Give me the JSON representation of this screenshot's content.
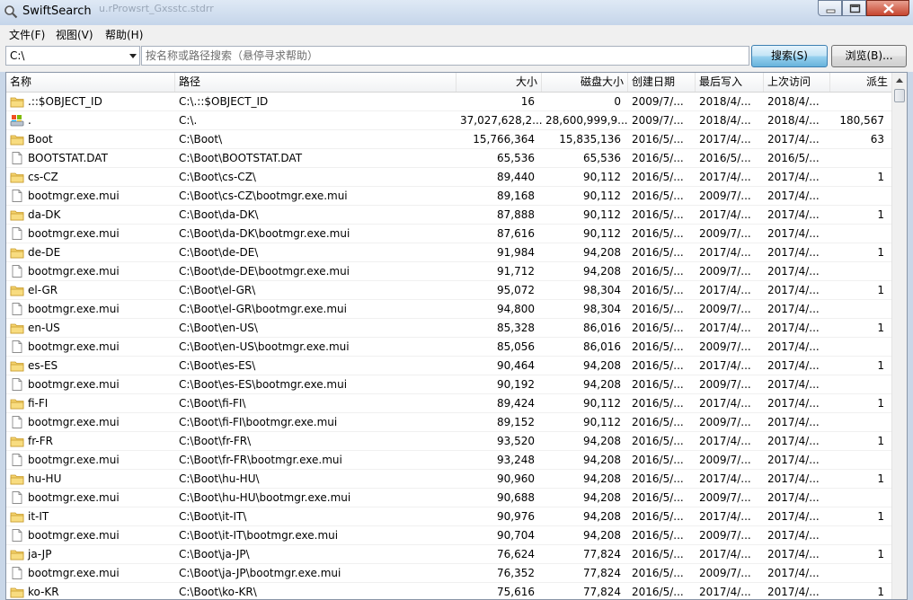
{
  "window": {
    "title": "SwiftSearch",
    "ghost_title": "u.rProwsrt_Gxsstc.stdrr"
  },
  "menu": [
    {
      "label": "文件(F)"
    },
    {
      "label": "视图(V)"
    },
    {
      "label": "帮助(H)"
    }
  ],
  "toolbar": {
    "drive": "C:\\",
    "search_placeholder": "按名称或路径搜索（悬停寻求帮助）",
    "search_value": "",
    "search_button": "搜索(S)",
    "browse_button": "浏览(B)..."
  },
  "columns": [
    "名称",
    "路径",
    "大小",
    "磁盘大小",
    "创建日期",
    "最后写入",
    "上次访问",
    "派生"
  ],
  "rows": [
    {
      "icon": "folder",
      "name": ".::$OBJECT_ID",
      "path": "C:\\.::$OBJECT_ID",
      "size": "16",
      "disk": "0",
      "created": "2009/7/...",
      "written": "2018/4/...",
      "accessed": "2018/4/...",
      "desc": ""
    },
    {
      "icon": "drive",
      "name": ".",
      "path": "C:\\.",
      "size": "37,027,628,2...",
      "disk": "28,600,999,9...",
      "created": "2009/7/...",
      "written": "2018/4/...",
      "accessed": "2018/4/...",
      "desc": "180,567"
    },
    {
      "icon": "folder",
      "name": "Boot",
      "path": "C:\\Boot\\",
      "size": "15,766,364",
      "disk": "15,835,136",
      "created": "2016/5/...",
      "written": "2017/4/...",
      "accessed": "2017/4/...",
      "desc": "63"
    },
    {
      "icon": "file",
      "name": "BOOTSTAT.DAT",
      "path": "C:\\Boot\\BOOTSTAT.DAT",
      "size": "65,536",
      "disk": "65,536",
      "created": "2016/5/...",
      "written": "2016/5/...",
      "accessed": "2016/5/...",
      "desc": ""
    },
    {
      "icon": "folder",
      "name": "cs-CZ",
      "path": "C:\\Boot\\cs-CZ\\",
      "size": "89,440",
      "disk": "90,112",
      "created": "2016/5/...",
      "written": "2017/4/...",
      "accessed": "2017/4/...",
      "desc": "1"
    },
    {
      "icon": "file",
      "name": "bootmgr.exe.mui",
      "path": "C:\\Boot\\cs-CZ\\bootmgr.exe.mui",
      "size": "89,168",
      "disk": "90,112",
      "created": "2016/5/...",
      "written": "2009/7/...",
      "accessed": "2017/4/...",
      "desc": ""
    },
    {
      "icon": "folder",
      "name": "da-DK",
      "path": "C:\\Boot\\da-DK\\",
      "size": "87,888",
      "disk": "90,112",
      "created": "2016/5/...",
      "written": "2017/4/...",
      "accessed": "2017/4/...",
      "desc": "1"
    },
    {
      "icon": "file",
      "name": "bootmgr.exe.mui",
      "path": "C:\\Boot\\da-DK\\bootmgr.exe.mui",
      "size": "87,616",
      "disk": "90,112",
      "created": "2016/5/...",
      "written": "2009/7/...",
      "accessed": "2017/4/...",
      "desc": ""
    },
    {
      "icon": "folder",
      "name": "de-DE",
      "path": "C:\\Boot\\de-DE\\",
      "size": "91,984",
      "disk": "94,208",
      "created": "2016/5/...",
      "written": "2017/4/...",
      "accessed": "2017/4/...",
      "desc": "1"
    },
    {
      "icon": "file",
      "name": "bootmgr.exe.mui",
      "path": "C:\\Boot\\de-DE\\bootmgr.exe.mui",
      "size": "91,712",
      "disk": "94,208",
      "created": "2016/5/...",
      "written": "2009/7/...",
      "accessed": "2017/4/...",
      "desc": ""
    },
    {
      "icon": "folder",
      "name": "el-GR",
      "path": "C:\\Boot\\el-GR\\",
      "size": "95,072",
      "disk": "98,304",
      "created": "2016/5/...",
      "written": "2017/4/...",
      "accessed": "2017/4/...",
      "desc": "1"
    },
    {
      "icon": "file",
      "name": "bootmgr.exe.mui",
      "path": "C:\\Boot\\el-GR\\bootmgr.exe.mui",
      "size": "94,800",
      "disk": "98,304",
      "created": "2016/5/...",
      "written": "2009/7/...",
      "accessed": "2017/4/...",
      "desc": ""
    },
    {
      "icon": "folder",
      "name": "en-US",
      "path": "C:\\Boot\\en-US\\",
      "size": "85,328",
      "disk": "86,016",
      "created": "2016/5/...",
      "written": "2017/4/...",
      "accessed": "2017/4/...",
      "desc": "1"
    },
    {
      "icon": "file",
      "name": "bootmgr.exe.mui",
      "path": "C:\\Boot\\en-US\\bootmgr.exe.mui",
      "size": "85,056",
      "disk": "86,016",
      "created": "2016/5/...",
      "written": "2009/7/...",
      "accessed": "2017/4/...",
      "desc": ""
    },
    {
      "icon": "folder",
      "name": "es-ES",
      "path": "C:\\Boot\\es-ES\\",
      "size": "90,464",
      "disk": "94,208",
      "created": "2016/5/...",
      "written": "2017/4/...",
      "accessed": "2017/4/...",
      "desc": "1"
    },
    {
      "icon": "file",
      "name": "bootmgr.exe.mui",
      "path": "C:\\Boot\\es-ES\\bootmgr.exe.mui",
      "size": "90,192",
      "disk": "94,208",
      "created": "2016/5/...",
      "written": "2009/7/...",
      "accessed": "2017/4/...",
      "desc": ""
    },
    {
      "icon": "folder",
      "name": "fi-FI",
      "path": "C:\\Boot\\fi-FI\\",
      "size": "89,424",
      "disk": "90,112",
      "created": "2016/5/...",
      "written": "2017/4/...",
      "accessed": "2017/4/...",
      "desc": "1"
    },
    {
      "icon": "file",
      "name": "bootmgr.exe.mui",
      "path": "C:\\Boot\\fi-FI\\bootmgr.exe.mui",
      "size": "89,152",
      "disk": "90,112",
      "created": "2016/5/...",
      "written": "2009/7/...",
      "accessed": "2017/4/...",
      "desc": ""
    },
    {
      "icon": "folder",
      "name": "fr-FR",
      "path": "C:\\Boot\\fr-FR\\",
      "size": "93,520",
      "disk": "94,208",
      "created": "2016/5/...",
      "written": "2017/4/...",
      "accessed": "2017/4/...",
      "desc": "1"
    },
    {
      "icon": "file",
      "name": "bootmgr.exe.mui",
      "path": "C:\\Boot\\fr-FR\\bootmgr.exe.mui",
      "size": "93,248",
      "disk": "94,208",
      "created": "2016/5/...",
      "written": "2009/7/...",
      "accessed": "2017/4/...",
      "desc": ""
    },
    {
      "icon": "folder",
      "name": "hu-HU",
      "path": "C:\\Boot\\hu-HU\\",
      "size": "90,960",
      "disk": "94,208",
      "created": "2016/5/...",
      "written": "2017/4/...",
      "accessed": "2017/4/...",
      "desc": "1"
    },
    {
      "icon": "file",
      "name": "bootmgr.exe.mui",
      "path": "C:\\Boot\\hu-HU\\bootmgr.exe.mui",
      "size": "90,688",
      "disk": "94,208",
      "created": "2016/5/...",
      "written": "2009/7/...",
      "accessed": "2017/4/...",
      "desc": ""
    },
    {
      "icon": "folder",
      "name": "it-IT",
      "path": "C:\\Boot\\it-IT\\",
      "size": "90,976",
      "disk": "94,208",
      "created": "2016/5/...",
      "written": "2017/4/...",
      "accessed": "2017/4/...",
      "desc": "1"
    },
    {
      "icon": "file",
      "name": "bootmgr.exe.mui",
      "path": "C:\\Boot\\it-IT\\bootmgr.exe.mui",
      "size": "90,704",
      "disk": "94,208",
      "created": "2016/5/...",
      "written": "2009/7/...",
      "accessed": "2017/4/...",
      "desc": ""
    },
    {
      "icon": "folder",
      "name": "ja-JP",
      "path": "C:\\Boot\\ja-JP\\",
      "size": "76,624",
      "disk": "77,824",
      "created": "2016/5/...",
      "written": "2017/4/...",
      "accessed": "2017/4/...",
      "desc": "1"
    },
    {
      "icon": "file",
      "name": "bootmgr.exe.mui",
      "path": "C:\\Boot\\ja-JP\\bootmgr.exe.mui",
      "size": "76,352",
      "disk": "77,824",
      "created": "2016/5/...",
      "written": "2009/7/...",
      "accessed": "2017/4/...",
      "desc": ""
    },
    {
      "icon": "folder",
      "name": "ko-KR",
      "path": "C:\\Boot\\ko-KR\\",
      "size": "75,616",
      "disk": "77,824",
      "created": "2016/5/...",
      "written": "2017/4/...",
      "accessed": "2017/4/...",
      "desc": "1"
    }
  ]
}
